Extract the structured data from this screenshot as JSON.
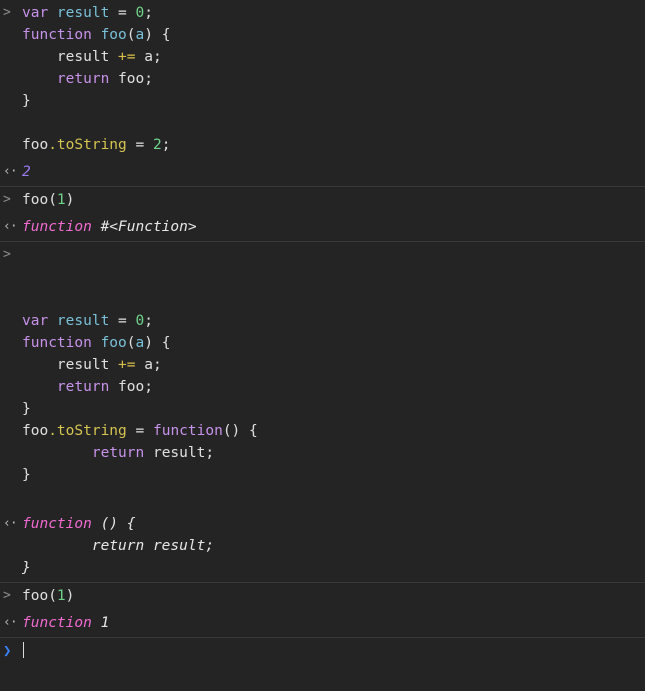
{
  "app": {
    "title": "JavaScript Console",
    "background": "#242424",
    "separator_color": "#3a3a3a"
  },
  "prompts": {
    "input_glyph": ">",
    "output_glyph": "‹·",
    "active_glyph": "❯",
    "input_glyph_name": "input-prompt-chevron",
    "output_glyph_name": "output-return-arrow",
    "active_glyph_name": "active-prompt-chevron"
  },
  "colors": {
    "keyword": "#c792ea",
    "declaration": "#79c0d8",
    "number": "#6fd38a",
    "property": "#d5c451",
    "operator": "#d7c04a",
    "plain": "#e0e0e0",
    "result_function": "#f06ad0",
    "result_number": "#9a7bf0",
    "active_prompt": "#3b82f6"
  },
  "entries": [
    {
      "kind": "input",
      "name": "console-input-first-snippet",
      "lines": [
        [
          {
            "t": "var ",
            "c": "kw"
          },
          {
            "t": "result",
            "c": "decl"
          },
          {
            "t": " ",
            "c": "plain"
          },
          {
            "t": "=",
            "c": "eq"
          },
          {
            "t": " ",
            "c": "plain"
          },
          {
            "t": "0",
            "c": "num"
          },
          {
            "t": ";",
            "c": "plain"
          }
        ],
        [
          {
            "t": "function ",
            "c": "kw"
          },
          {
            "t": "foo",
            "c": "fname"
          },
          {
            "t": "(",
            "c": "plain"
          },
          {
            "t": "a",
            "c": "param"
          },
          {
            "t": ") {",
            "c": "plain"
          }
        ],
        [
          {
            "t": "    result ",
            "c": "plain"
          },
          {
            "t": "+=",
            "c": "op"
          },
          {
            "t": " a;",
            "c": "plain"
          }
        ],
        [
          {
            "t": "    ",
            "c": "plain"
          },
          {
            "t": "return",
            "c": "kw"
          },
          {
            "t": " foo;",
            "c": "plain"
          }
        ],
        [
          {
            "t": "}",
            "c": "plain"
          }
        ],
        [
          {
            "t": "",
            "c": "plain"
          }
        ],
        [
          {
            "t": "foo",
            "c": "plain"
          },
          {
            "t": ".toString",
            "c": "prop"
          },
          {
            "t": " ",
            "c": "plain"
          },
          {
            "t": "=",
            "c": "eq"
          },
          {
            "t": " ",
            "c": "plain"
          },
          {
            "t": "2",
            "c": "num"
          },
          {
            "t": ";",
            "c": "plain"
          }
        ]
      ]
    },
    {
      "kind": "output",
      "name": "console-output-two",
      "lines": [
        [
          {
            "t": "2",
            "c": "resnum"
          }
        ]
      ]
    },
    {
      "kind": "input",
      "name": "console-input-foo-call-1",
      "lines": [
        [
          {
            "t": "foo(",
            "c": "plain"
          },
          {
            "t": "1",
            "c": "num"
          },
          {
            "t": ")",
            "c": "plain"
          }
        ]
      ]
    },
    {
      "kind": "output",
      "name": "console-output-function-hash",
      "lines": [
        [
          {
            "t": "function ",
            "c": "fnkw"
          },
          {
            "t": "#<Function>",
            "c": "val"
          }
        ]
      ]
    },
    {
      "kind": "input",
      "name": "console-input-second-snippet",
      "lines": [
        [
          {
            "t": "",
            "c": "plain"
          }
        ],
        [
          {
            "t": "",
            "c": "plain"
          }
        ],
        [
          {
            "t": "",
            "c": "plain"
          }
        ],
        [
          {
            "t": "var ",
            "c": "kw"
          },
          {
            "t": "result",
            "c": "decl"
          },
          {
            "t": " ",
            "c": "plain"
          },
          {
            "t": "=",
            "c": "eq"
          },
          {
            "t": " ",
            "c": "plain"
          },
          {
            "t": "0",
            "c": "num"
          },
          {
            "t": ";",
            "c": "plain"
          }
        ],
        [
          {
            "t": "function ",
            "c": "kw"
          },
          {
            "t": "foo",
            "c": "fname"
          },
          {
            "t": "(",
            "c": "plain"
          },
          {
            "t": "a",
            "c": "param"
          },
          {
            "t": ") {",
            "c": "plain"
          }
        ],
        [
          {
            "t": "    result ",
            "c": "plain"
          },
          {
            "t": "+=",
            "c": "op"
          },
          {
            "t": " a;",
            "c": "plain"
          }
        ],
        [
          {
            "t": "    ",
            "c": "plain"
          },
          {
            "t": "return",
            "c": "kw"
          },
          {
            "t": " foo;",
            "c": "plain"
          }
        ],
        [
          {
            "t": "}",
            "c": "plain"
          }
        ],
        [
          {
            "t": "foo",
            "c": "plain"
          },
          {
            "t": ".toString",
            "c": "prop"
          },
          {
            "t": " ",
            "c": "plain"
          },
          {
            "t": "=",
            "c": "eq"
          },
          {
            "t": " ",
            "c": "plain"
          },
          {
            "t": "function",
            "c": "kw"
          },
          {
            "t": "() {",
            "c": "plain"
          }
        ],
        [
          {
            "t": "        ",
            "c": "plain"
          },
          {
            "t": "return",
            "c": "kw"
          },
          {
            "t": " result;",
            "c": "plain"
          }
        ],
        [
          {
            "t": "}",
            "c": "plain"
          }
        ],
        [
          {
            "t": "",
            "c": "plain"
          }
        ]
      ]
    },
    {
      "kind": "output",
      "name": "console-output-function-source",
      "lines": [
        [
          {
            "t": "function ",
            "c": "fnkw"
          },
          {
            "t": "() {",
            "c": "val"
          }
        ],
        [
          {
            "t": "        return result;",
            "c": "val"
          }
        ],
        [
          {
            "t": "}",
            "c": "val"
          }
        ]
      ]
    },
    {
      "kind": "input",
      "name": "console-input-foo-call-2",
      "lines": [
        [
          {
            "t": "foo(",
            "c": "plain"
          },
          {
            "t": "1",
            "c": "num"
          },
          {
            "t": ")",
            "c": "plain"
          }
        ]
      ]
    },
    {
      "kind": "output",
      "name": "console-output-function-one",
      "lines": [
        [
          {
            "t": "function ",
            "c": "fnkw"
          },
          {
            "t": "1",
            "c": "val"
          }
        ]
      ]
    },
    {
      "kind": "active",
      "name": "console-active-prompt",
      "lines": [
        [
          {
            "t": "",
            "c": "plain"
          }
        ]
      ]
    }
  ]
}
